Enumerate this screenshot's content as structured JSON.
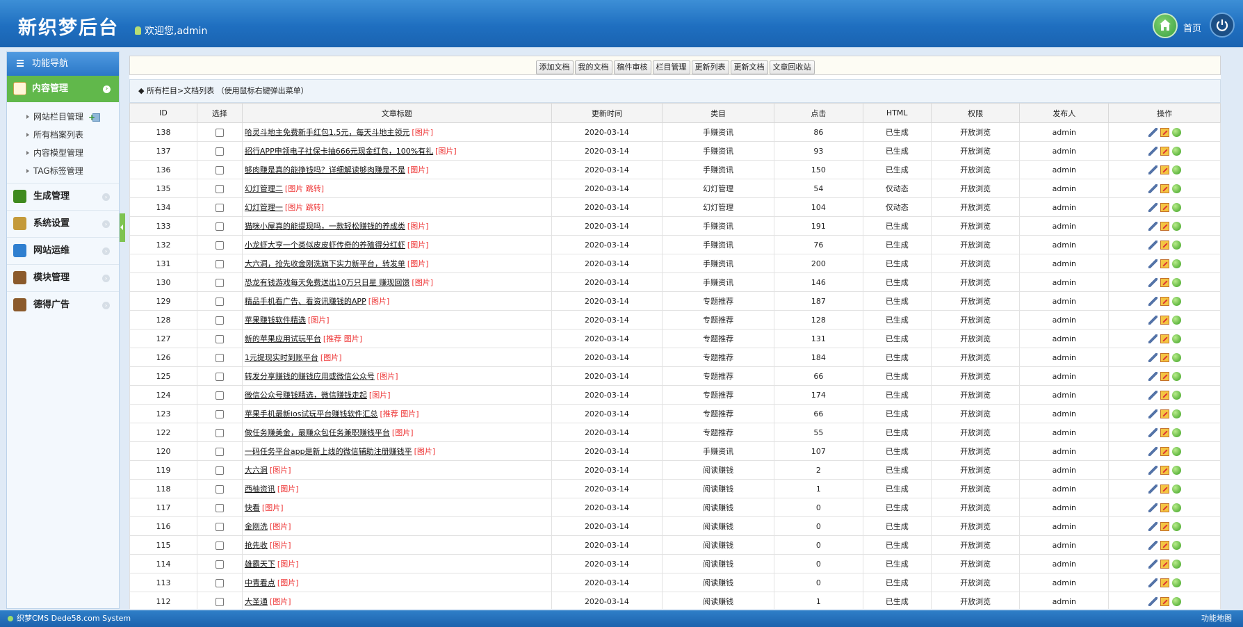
{
  "header": {
    "logo": "新织梦后台",
    "welcome": "欢迎您,admin",
    "home_label": "首页"
  },
  "sidebar": {
    "title": "功能导航",
    "active_section": "内容管理",
    "sub_items": [
      "网站栏目管理",
      "所有档案列表",
      "内容模型管理",
      "TAG标签管理"
    ],
    "sections": [
      {
        "label": "生成管理",
        "icon": "tree-icon",
        "color": "#3f8a1f"
      },
      {
        "label": "系统设置",
        "icon": "settings-icon",
        "color": "#c49a3a"
      },
      {
        "label": "网站运维",
        "icon": "monitor-icon",
        "color": "#2f7fd0"
      },
      {
        "label": "模块管理",
        "icon": "book-icon",
        "color": "#8b5a2b"
      },
      {
        "label": "德得广告",
        "icon": "book-icon",
        "color": "#8b5a2b"
      }
    ]
  },
  "toolbar": {
    "buttons": [
      "添加文档",
      "我的文档",
      "稿件审核",
      "栏目管理",
      "更新列表",
      "更新文档",
      "文章回收站"
    ]
  },
  "breadcrumb": "◆  所有栏目>文档列表   （使用鼠标右键弹出菜单）",
  "table": {
    "columns": [
      "ID",
      "选择",
      "文章标题",
      "更新时间",
      "类目",
      "点击",
      "HTML",
      "权限",
      "发布人",
      "操作"
    ],
    "rows": [
      {
        "id": "138",
        "title": "哈灵斗地主免费新手红包1.5元，每天斗地主领元",
        "tag": "[图片]",
        "date": "2020-03-14",
        "cat": "手赚资讯",
        "clicks": "86",
        "html": "已生成",
        "perm": "开放浏览",
        "author": "admin"
      },
      {
        "id": "137",
        "title": "招行APP申领电子社保卡抽666元现金红包，100%有礼",
        "tag": "[图片]",
        "date": "2020-03-14",
        "cat": "手赚资讯",
        "clicks": "93",
        "html": "已生成",
        "perm": "开放浏览",
        "author": "admin"
      },
      {
        "id": "136",
        "title": "够肉赚是真的能挣钱吗？详细解读够肉赚是不是",
        "tag": "[图片]",
        "date": "2020-03-14",
        "cat": "手赚资讯",
        "clicks": "150",
        "html": "已生成",
        "perm": "开放浏览",
        "author": "admin"
      },
      {
        "id": "135",
        "title": "幻灯管理二",
        "tag": "[图片 跳转]",
        "date": "2020-03-14",
        "cat": "幻灯管理",
        "clicks": "54",
        "html": "仅动态",
        "perm": "开放浏览",
        "author": "admin"
      },
      {
        "id": "134",
        "title": "幻灯管理一",
        "tag": "[图片 跳转]",
        "date": "2020-03-14",
        "cat": "幻灯管理",
        "clicks": "104",
        "html": "仅动态",
        "perm": "开放浏览",
        "author": "admin"
      },
      {
        "id": "133",
        "title": "猫咪小屋真的能提现吗，一款轻松赚钱的养成类",
        "tag": "[图片]",
        "date": "2020-03-14",
        "cat": "手赚资讯",
        "clicks": "191",
        "html": "已生成",
        "perm": "开放浏览",
        "author": "admin"
      },
      {
        "id": "132",
        "title": "小龙虾大亨一个类似皮皮虾传奇的养殖得分红虾",
        "tag": "[图片]",
        "date": "2020-03-14",
        "cat": "手赚资讯",
        "clicks": "76",
        "html": "已生成",
        "perm": "开放浏览",
        "author": "admin"
      },
      {
        "id": "131",
        "title": "大六洞，抢先收金刚洗旗下实力新平台，转发单",
        "tag": "[图片]",
        "date": "2020-03-14",
        "cat": "手赚资讯",
        "clicks": "200",
        "html": "已生成",
        "perm": "开放浏览",
        "author": "admin"
      },
      {
        "id": "130",
        "title": "恐龙有钱游戏每天免费送出10万只日星 赚现回馈",
        "tag": "[图片]",
        "date": "2020-03-14",
        "cat": "手赚资讯",
        "clicks": "146",
        "html": "已生成",
        "perm": "开放浏览",
        "author": "admin"
      },
      {
        "id": "129",
        "title": "精品手机看广告、看资讯赚钱的APP",
        "tag": "[图片]",
        "date": "2020-03-14",
        "cat": "专题推荐",
        "clicks": "187",
        "html": "已生成",
        "perm": "开放浏览",
        "author": "admin"
      },
      {
        "id": "128",
        "title": "苹果赚钱软件精选",
        "tag": "[图片]",
        "date": "2020-03-14",
        "cat": "专题推荐",
        "clicks": "128",
        "html": "已生成",
        "perm": "开放浏览",
        "author": "admin"
      },
      {
        "id": "127",
        "title": "新的苹果应用试玩平台",
        "tag": "[推荐 图片]",
        "date": "2020-03-14",
        "cat": "专题推荐",
        "clicks": "131",
        "html": "已生成",
        "perm": "开放浏览",
        "author": "admin"
      },
      {
        "id": "126",
        "title": "1元提现实时到账平台",
        "tag": "[图片]",
        "date": "2020-03-14",
        "cat": "专题推荐",
        "clicks": "184",
        "html": "已生成",
        "perm": "开放浏览",
        "author": "admin"
      },
      {
        "id": "125",
        "title": "转发分享赚钱的赚钱应用或微信公众号",
        "tag": "[图片]",
        "date": "2020-03-14",
        "cat": "专题推荐",
        "clicks": "66",
        "html": "已生成",
        "perm": "开放浏览",
        "author": "admin"
      },
      {
        "id": "124",
        "title": "微信公众号赚钱精选，微信赚钱走起",
        "tag": "[图片]",
        "date": "2020-03-14",
        "cat": "专题推荐",
        "clicks": "174",
        "html": "已生成",
        "perm": "开放浏览",
        "author": "admin"
      },
      {
        "id": "123",
        "title": "苹果手机最新ios试玩平台赚钱软件汇总",
        "tag": "[推荐 图片]",
        "date": "2020-03-14",
        "cat": "专题推荐",
        "clicks": "66",
        "html": "已生成",
        "perm": "开放浏览",
        "author": "admin"
      },
      {
        "id": "122",
        "title": "做任务赚美金，最赚众包任务兼职赚钱平台",
        "tag": "[图片]",
        "date": "2020-03-14",
        "cat": "专题推荐",
        "clicks": "55",
        "html": "已生成",
        "perm": "开放浏览",
        "author": "admin"
      },
      {
        "id": "120",
        "title": "一码任务平台app是新上线的微信辅助注册赚钱平",
        "tag": "[图片]",
        "date": "2020-03-14",
        "cat": "手赚资讯",
        "clicks": "107",
        "html": "已生成",
        "perm": "开放浏览",
        "author": "admin"
      },
      {
        "id": "119",
        "title": "大六洞",
        "tag": "[图片]",
        "date": "2020-03-14",
        "cat": "阅读赚钱",
        "clicks": "2",
        "html": "已生成",
        "perm": "开放浏览",
        "author": "admin"
      },
      {
        "id": "118",
        "title": "西柚资讯",
        "tag": "[图片]",
        "date": "2020-03-14",
        "cat": "阅读赚钱",
        "clicks": "1",
        "html": "已生成",
        "perm": "开放浏览",
        "author": "admin"
      },
      {
        "id": "117",
        "title": "快看",
        "tag": "[图片]",
        "date": "2020-03-14",
        "cat": "阅读赚钱",
        "clicks": "0",
        "html": "已生成",
        "perm": "开放浏览",
        "author": "admin"
      },
      {
        "id": "116",
        "title": "金刚洗",
        "tag": "[图片]",
        "date": "2020-03-14",
        "cat": "阅读赚钱",
        "clicks": "0",
        "html": "已生成",
        "perm": "开放浏览",
        "author": "admin"
      },
      {
        "id": "115",
        "title": "抢先收",
        "tag": "[图片]",
        "date": "2020-03-14",
        "cat": "阅读赚钱",
        "clicks": "0",
        "html": "已生成",
        "perm": "开放浏览",
        "author": "admin"
      },
      {
        "id": "114",
        "title": "雄霸天下",
        "tag": "[图片]",
        "date": "2020-03-14",
        "cat": "阅读赚钱",
        "clicks": "0",
        "html": "已生成",
        "perm": "开放浏览",
        "author": "admin"
      },
      {
        "id": "113",
        "title": "中青看点",
        "tag": "[图片]",
        "date": "2020-03-14",
        "cat": "阅读赚钱",
        "clicks": "0",
        "html": "已生成",
        "perm": "开放浏览",
        "author": "admin"
      },
      {
        "id": "112",
        "title": "大圣通",
        "tag": "[图片]",
        "date": "2020-03-14",
        "cat": "阅读赚钱",
        "clicks": "1",
        "html": "已生成",
        "perm": "开放浏览",
        "author": "admin"
      }
    ]
  },
  "footer": {
    "left": "织梦CMS  Dede58.com System",
    "right": "功能地图"
  }
}
